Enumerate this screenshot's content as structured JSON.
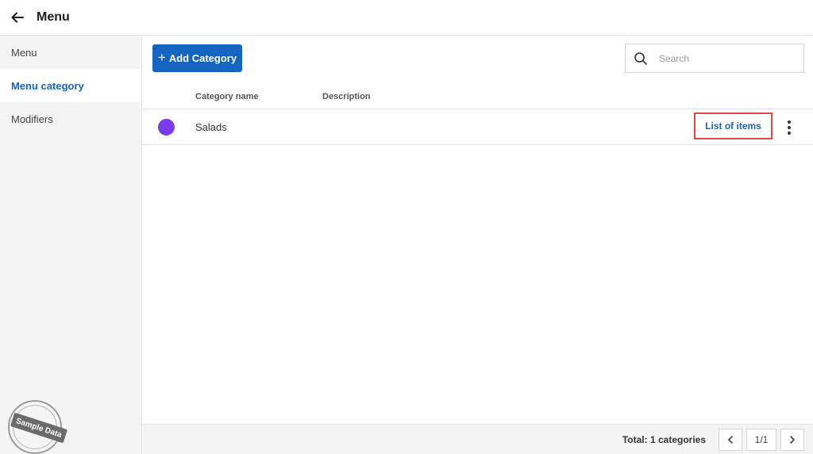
{
  "header": {
    "title": "Menu",
    "back_icon": "arrow-left-icon"
  },
  "sidebar": {
    "items": [
      {
        "label": "Menu",
        "active": false
      },
      {
        "label": "Menu category",
        "active": true
      },
      {
        "label": "Modifiers",
        "active": false
      }
    ],
    "stamp_text": "Sample Data"
  },
  "toolbar": {
    "add_label": "Add Category",
    "add_icon": "plus-icon",
    "search_placeholder": "Search",
    "search_value": "",
    "search_icon": "search-icon"
  },
  "table": {
    "columns": [
      "Category name",
      "Description"
    ],
    "rows": [
      {
        "color": "#7c3aed",
        "name": "Salads",
        "description": "",
        "action_label": "List of items",
        "more_icon": "more-vertical-icon"
      }
    ]
  },
  "footer": {
    "total": "Total: 1 categories",
    "page": "1/1",
    "prev_icon": "chevron-left-icon",
    "next_icon": "chevron-right-icon"
  },
  "colors": {
    "accent": "#1565c0",
    "highlight_border": "#e04848",
    "category_dot": "#7c3aed"
  }
}
